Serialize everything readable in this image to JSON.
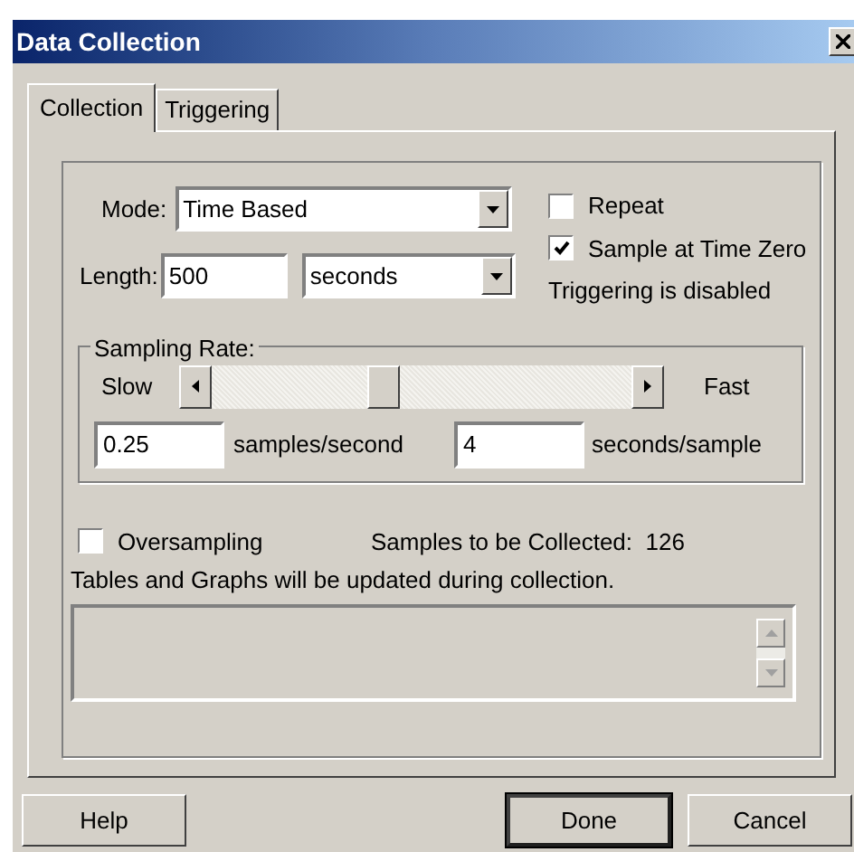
{
  "window": {
    "title": "Data Collection"
  },
  "tabs": [
    {
      "label": "Collection",
      "selected": true
    },
    {
      "label": "Triggering",
      "selected": false
    }
  ],
  "mode": {
    "label": "Mode:",
    "value": "Time Based"
  },
  "length": {
    "label": "Length:",
    "value": "500",
    "unit": "seconds"
  },
  "repeat": {
    "label": "Repeat",
    "checked": false
  },
  "sample_at_zero": {
    "label": "Sample at Time Zero",
    "checked": true
  },
  "triggering_status": "Triggering is disabled",
  "sampling_rate": {
    "title": "Sampling Rate:",
    "slow_label": "Slow",
    "fast_label": "Fast",
    "level": 0.4,
    "rate_value": "0.25",
    "rate_unit": "samples/second",
    "period_value": "4",
    "period_unit": "seconds/sample"
  },
  "oversampling": {
    "label": "Oversampling",
    "checked": false
  },
  "samples_to_collect": "Samples to be Collected:  126",
  "update_note": "Tables and Graphs will be updated during collection.",
  "buttons": [
    {
      "label": "Help"
    },
    {
      "label": "Done",
      "default": true
    },
    {
      "label": "Cancel",
      "default": false
    }
  ]
}
